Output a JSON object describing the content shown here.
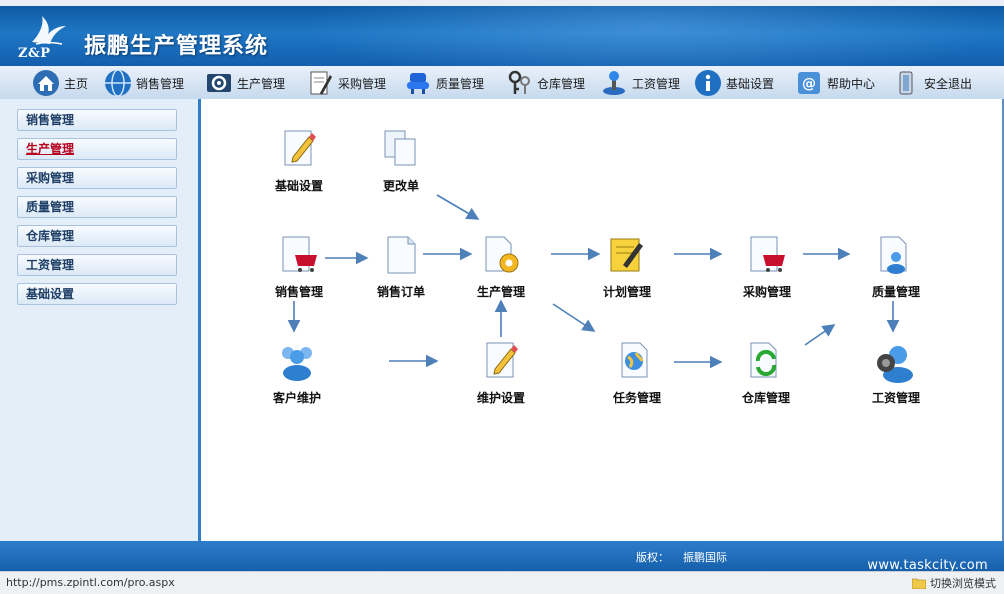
{
  "app": {
    "logo_text": "Z&P",
    "title": "振鹏生产管理系统"
  },
  "nav": [
    {
      "label": "主页",
      "icon": "home-icon"
    },
    {
      "label": "销售管理",
      "icon": "globe-icon"
    },
    {
      "label": "生产管理",
      "icon": "gear-box-icon"
    },
    {
      "label": "采购管理",
      "icon": "document-pen-icon"
    },
    {
      "label": "质量管理",
      "icon": "blue-chair-icon"
    },
    {
      "label": "仓库管理",
      "icon": "keys-icon"
    },
    {
      "label": "工资管理",
      "icon": "joystick-icon"
    },
    {
      "label": "基础设置",
      "icon": "info-icon"
    },
    {
      "label": "帮助中心",
      "icon": "email-icon"
    },
    {
      "label": "安全退出",
      "icon": "exit-icon"
    }
  ],
  "sidebar": {
    "active_index": 1,
    "items": [
      {
        "label": "销售管理"
      },
      {
        "label": "生产管理"
      },
      {
        "label": "采购管理"
      },
      {
        "label": "质量管理"
      },
      {
        "label": "仓库管理"
      },
      {
        "label": "工资管理"
      },
      {
        "label": "基础设置"
      }
    ]
  },
  "flow": {
    "nodes": {
      "basic_settings": {
        "label": "基础设置",
        "icon": "document-pencil-icon"
      },
      "change_order": {
        "label": "更改单",
        "icon": "document-copy-icon"
      },
      "sales_management": {
        "label": "销售管理",
        "icon": "document-cart-icon"
      },
      "sales_order": {
        "label": "销售订单",
        "icon": "document-icon"
      },
      "production_management": {
        "label": "生产管理",
        "icon": "document-gear-icon"
      },
      "plan_management": {
        "label": "计划管理",
        "icon": "notepad-pencil-icon"
      },
      "purchase_management": {
        "label": "采购管理",
        "icon": "document-cart-icon"
      },
      "quality_management": {
        "label": "质量管理",
        "icon": "document-users-icon"
      },
      "customer_maintenance": {
        "label": "客户维护",
        "icon": "users-icon"
      },
      "maintenance_settings": {
        "label": "维护设置",
        "icon": "document-pencil-icon"
      },
      "task_management": {
        "label": "任务管理",
        "icon": "document-globe-icon"
      },
      "warehouse_management": {
        "label": "仓库管理",
        "icon": "document-refresh-icon"
      },
      "salary_management": {
        "label": "工资管理",
        "icon": "user-speaker-icon"
      }
    },
    "colors": {
      "arrow": "#4d7fb8"
    }
  },
  "footer": {
    "copyright_label": "版权：",
    "copyright_value": "振鹏国际",
    "watermark": "www.taskcity.com"
  },
  "statusbar": {
    "url": "http://pms.zpintl.com/pro.aspx",
    "mode_label": "切换浏览模式"
  },
  "colors": {
    "header_blue": "#135fae",
    "sidebar_bg": "#e4eef9",
    "active_red": "#b8001c",
    "footer_blue": "#1f6dbb"
  }
}
